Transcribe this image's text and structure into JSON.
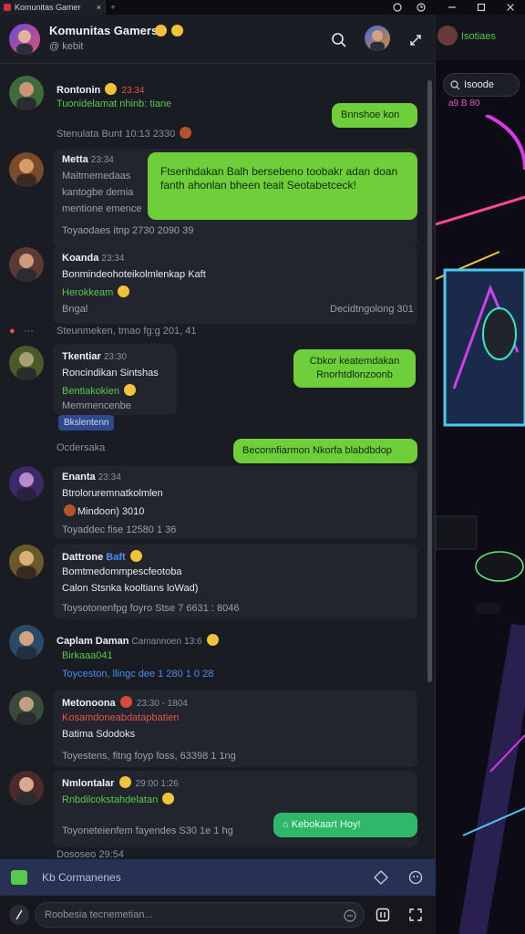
{
  "window": {
    "tab_label": "Komunitas Gamer",
    "new_tab": "+",
    "close_tab": "×"
  },
  "header": {
    "title": "Komunitas Gamers",
    "subtitle": "@ kebit"
  },
  "messages": [
    {
      "name": "Rontonin",
      "time": "23:34",
      "lines": [
        "Tuonidelamat nhinb: tiane"
      ]
    },
    {
      "system": "Stenulata Bunt 10:13 2330"
    },
    {
      "name": "Metta",
      "time": "23:34",
      "lines": [
        "Maitmemedaas",
        "kantogbe demia",
        "mentione emence"
      ],
      "footer": "Toyaodaes itnp 2730 2090 39"
    },
    {
      "name": "Koanda",
      "time": "23:34",
      "lines": [
        "Bonmindeohoteikolmlenkap Kaft",
        "Herokkeam",
        "Bngal"
      ],
      "footer": "Decidtngolong 301"
    },
    {
      "system": "Steunmeken, tmao fg:g 201, 41"
    },
    {
      "name": "Tkentiar",
      "time": "23:30",
      "lines": [
        "Roncindikan Sintshas",
        "Bentiakokien",
        "Memmencenbe"
      ],
      "button": "Bkslentenn"
    },
    {
      "system": "Ocdersaka"
    },
    {
      "name": "Enanta",
      "time": "23:34",
      "lines": [
        "Btroloruremnatkolmlen",
        "Mindoon) 3010"
      ],
      "footer": "Toyaddec fise 12580 1 36"
    },
    {
      "name": "Dattrone",
      "time": "23:34",
      "tag": "Baft",
      "lines": [
        "Bomtmedommpescfeotoba",
        "Calon  Stsnka kooltians loWad)"
      ],
      "footer": "Toysotonenfpg foyro Stse 7 6631 : 8046"
    },
    {
      "name": "Caplam Daman",
      "time": "13:6",
      "tag": "Camannoen",
      "lines": [
        "Birkaaa041",
        "Toyceston, llingc dee 1 280 1 0 28"
      ]
    },
    {
      "name": "Metonoona",
      "time": "23:30 - 1804",
      "lines": [
        "Kosamdoneabdatapbatien",
        "Batima Sdodoks"
      ],
      "footer": "Toyestens, fitng foyp foss, 63398 1 1ng"
    },
    {
      "name": "Nmlontalar",
      "time": "29:00 1:26",
      "lines": [
        "Rnbdilcokstahdelatan"
      ],
      "footer": "Toyoneteienfem fayendes S30 1e 1 hg"
    },
    {
      "system": "Dososeo 29:54"
    }
  ],
  "outgoing": [
    {
      "text": "Bnnshoe kon"
    },
    {
      "text": "Ftsenhdakan Balh bersebeno toobakr adan doan fanth ahonlan bheen teait Seotabetceck!"
    },
    {
      "text": "Cbkor keatemdakan Rnorhtdlonzoonb"
    },
    {
      "text": "Beconnfiarmon Nkorfa blabdbdop"
    },
    {
      "text": "Kebokaart Hoy!"
    }
  ],
  "composer": {
    "text": "Kb Cormanenes"
  },
  "input": {
    "placeholder": "Roobesia tecnemetian..."
  },
  "right_panel": {
    "title": "Isotiaes",
    "search": "Isoode",
    "meta": "a9 B 80"
  },
  "colors": {
    "outgoing_bubble": "#6fcf3a",
    "accent_green": "#58c94a",
    "accent_red": "#e2544a",
    "accent_blue": "#4a8cf0"
  }
}
